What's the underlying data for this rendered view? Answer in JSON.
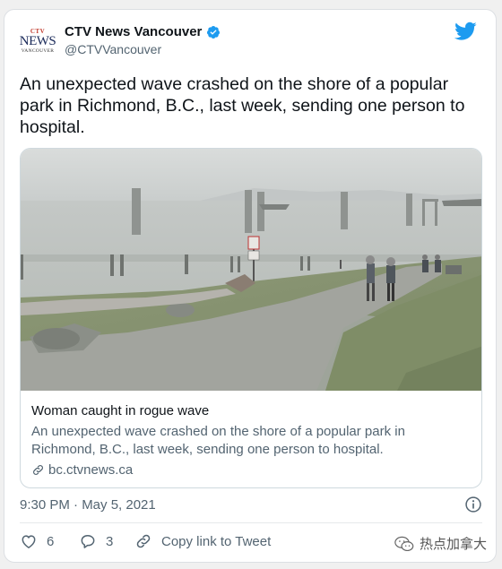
{
  "author": {
    "display_name": "CTV News Vancouver",
    "handle": "@CTVVancouver",
    "logo_text": {
      "top": "CTV",
      "main": "NEWS",
      "bottom": "VANCOUVER"
    }
  },
  "tweet": {
    "text": "An unexpected wave crashed on the shore of a popular park in Richmond, B.C., last week, sending one person to hospital.",
    "timestamp": "9:30 PM · May 5, 2021"
  },
  "link_card": {
    "title": "Woman caught in rogue wave",
    "description": "An unexpected wave crashed on the shore of a popular park in Richmond, B.C., last week, sending one person to hospital.",
    "domain": "bc.ctvnews.ca"
  },
  "actions": {
    "like_count": "6",
    "reply_count": "3",
    "copy_link_label": "Copy link to Tweet"
  },
  "watermark": {
    "text": "热点加拿大"
  },
  "icons": {
    "verified": "verified-badge-icon",
    "twitter": "twitter-bird-icon",
    "info": "info-icon",
    "like": "heart-icon",
    "reply": "speech-bubble-icon",
    "copy_link": "link-icon",
    "wechat": "wechat-icon"
  },
  "colors": {
    "accent": "#1d9bf0",
    "secondary_text": "#536471",
    "primary_text": "#0f1419"
  }
}
